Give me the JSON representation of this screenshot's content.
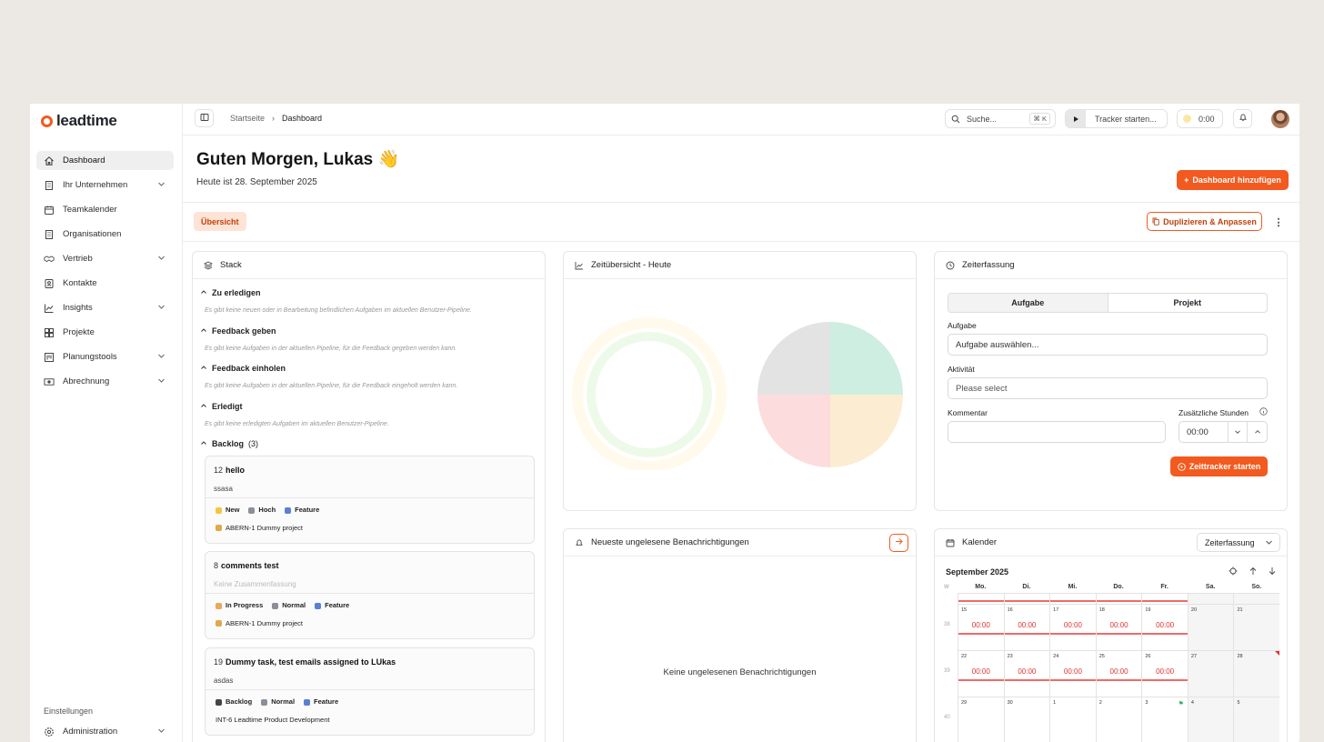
{
  "brand": {
    "name": "leadtime",
    "accent": "#f25a1f"
  },
  "sidebar": {
    "items": [
      {
        "label": "Dashboard",
        "icon": "home-icon",
        "active": true,
        "chevron": false
      },
      {
        "label": "Ihr Unternehmen",
        "icon": "building-icon",
        "chevron": true
      },
      {
        "label": "Teamkalender",
        "icon": "calendar-icon",
        "chevron": false
      },
      {
        "label": "Organisationen",
        "icon": "building-icon",
        "chevron": false
      },
      {
        "label": "Vertrieb",
        "icon": "handshake-icon",
        "chevron": true
      },
      {
        "label": "Kontakte",
        "icon": "contact-icon",
        "chevron": false
      },
      {
        "label": "Insights",
        "icon": "chart-icon",
        "chevron": true
      },
      {
        "label": "Projekte",
        "icon": "projects-icon",
        "chevron": false
      },
      {
        "label": "Planungstools",
        "icon": "kanban-icon",
        "chevron": true
      },
      {
        "label": "Abrechnung",
        "icon": "money-icon",
        "chevron": true
      }
    ],
    "settings_label": "Einstellungen",
    "admin_label": "Administration"
  },
  "topbar": {
    "breadcrumb": [
      "Startseite",
      "Dashboard"
    ],
    "search_placeholder": "Suche...",
    "search_shortcut": "⌘ K",
    "tracker_label": "Tracker starten...",
    "timer_value": "0:00"
  },
  "header": {
    "greeting": "Guten Morgen, Lukas 👋",
    "date_text": "Heute ist 28. September 2025",
    "add_dashboard_label": "Dashboard hinzufügen"
  },
  "tabs": {
    "overview_label": "Übersicht",
    "duplicate_label": "Duplizieren & Anpassen"
  },
  "stack": {
    "title": "Stack",
    "sections": [
      {
        "title": "Zu erledigen",
        "empty": "Es gibt keine neuen oder in Bearbeitung befindlichen Aufgaben im aktuellen Benutzer-Pipeline."
      },
      {
        "title": "Feedback geben",
        "empty": "Es gibt keine Aufgaben in der aktuellen Pipeline, für die Feedback gegeben werden kann."
      },
      {
        "title": "Feedback einholen",
        "empty": "Es gibt keine Aufgaben in der aktuellen Pipeline, für die Feedback eingeholt werden kann."
      },
      {
        "title": "Erledigt",
        "empty": "Es gibt keine erledigten Aufgaben im aktuellen Benutzer-Pipeline."
      }
    ],
    "backlog_title": "Backlog",
    "backlog_count": "(3)",
    "tasks": [
      {
        "num": "12",
        "name": "hello",
        "summary": "ssasa",
        "status": "New",
        "priority": "Hoch",
        "type": "Feature",
        "project": "ABERN-1 Dummy project"
      },
      {
        "num": "8",
        "name": "comments test",
        "summary": "Keine Zusammenfassung",
        "status": "In Progress",
        "priority": "Normal",
        "type": "Feature",
        "project": "ABERN-1 Dummy project"
      },
      {
        "num": "19",
        "name": "Dummy task, test emails assigned to LUkas",
        "summary": "asdas",
        "status": "Backlog",
        "priority": "Normal",
        "type": "Feature",
        "project": "INT-6 Leadtime Product Development"
      }
    ]
  },
  "time_overview": {
    "title": "Zeitübersicht - Heute"
  },
  "notifications": {
    "title": "Neueste ungelesene Benachrichtigungen",
    "empty": "Keine ungelesenen Benachrichtigungen"
  },
  "time_tracking": {
    "title": "Zeiterfassung",
    "tab_task": "Aufgabe",
    "tab_project": "Projekt",
    "task_label": "Aufgabe",
    "task_placeholder": "Aufgabe auswählen...",
    "activity_label": "Aktivität",
    "activity_placeholder": "Please select",
    "comment_label": "Kommentar",
    "extra_hours_label": "Zusätzliche Stunden",
    "extra_hours_value": "00:00",
    "start_label": "Zeittracker starten"
  },
  "calendar": {
    "title": "Kalender",
    "filter": "Zeiterfassung",
    "month": "September 2025",
    "week_col": "W",
    "days": [
      "Mo.",
      "Di.",
      "Mi.",
      "Do.",
      "Fr.",
      "Sa.",
      "So."
    ],
    "weeks": [
      {
        "kw": "38",
        "dates": [
          "15",
          "16",
          "17",
          "18",
          "19",
          "20",
          "21"
        ],
        "times": [
          "00:00",
          "00:00",
          "00:00",
          "00:00",
          "00:00"
        ]
      },
      {
        "kw": "39",
        "dates": [
          "22",
          "23",
          "24",
          "25",
          "26",
          "27",
          "28"
        ],
        "times": [
          "00:00",
          "00:00",
          "00:00",
          "00:00",
          "00:00"
        ]
      },
      {
        "kw": "40",
        "dates": [
          "29",
          "30",
          "1",
          "2",
          "3",
          "4",
          "5"
        ],
        "times": []
      }
    ]
  }
}
